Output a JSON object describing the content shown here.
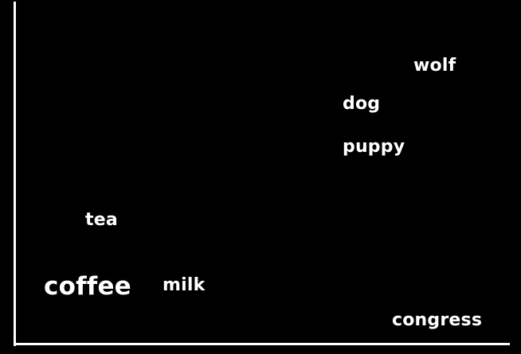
{
  "words": {
    "wolf": "wolf",
    "dog": "dog",
    "puppy": "puppy",
    "tea": "tea",
    "coffee": "coffee",
    "milk": "milk",
    "congress": "congress"
  },
  "colors": {
    "background": "#000000",
    "text": "#ffffff",
    "axis": "#ffffff"
  }
}
